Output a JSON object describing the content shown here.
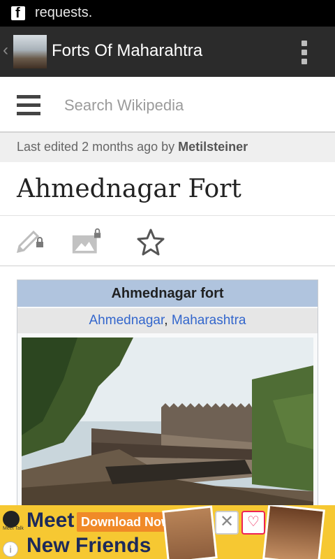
{
  "status_bar": {
    "notification_text": "requests."
  },
  "action_bar": {
    "title": "Forts Of Maharahtra"
  },
  "search": {
    "placeholder": "Search Wikipedia"
  },
  "last_edited": {
    "prefix": "Last edited 2 months ago by ",
    "user": "Metilsteiner"
  },
  "article": {
    "title": "Ahmednagar Fort",
    "infobox": {
      "caption": "Ahmednagar fort",
      "location_city": "Ahmednagar",
      "location_separator": ", ",
      "location_state": "Maharashtra"
    }
  },
  "ad": {
    "line1": "Meet",
    "button": "Download Now",
    "line2": "New Friends",
    "brand_small": "Meet Talk"
  },
  "colors": {
    "status_bar": "#000000",
    "action_bar": "#2b2b2b",
    "link": "#3366cc",
    "infobox_caption_bg": "#b0c4de",
    "ad_bg": "#f6c832",
    "ad_button": "#f08a28"
  }
}
